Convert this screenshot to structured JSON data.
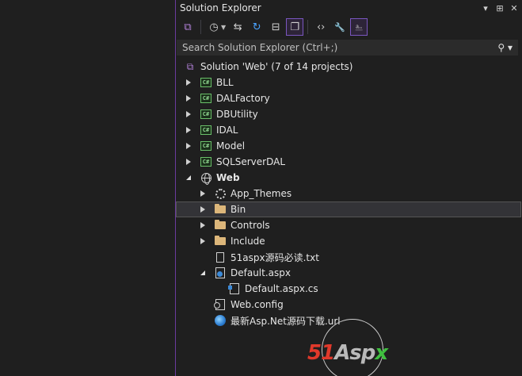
{
  "panel": {
    "title": "Solution Explorer",
    "window_controls": {
      "dropdown": "▾",
      "pin": "⊞",
      "close": "✕"
    }
  },
  "toolbar": {
    "buttons": [
      {
        "icon": "vs-solution-icon",
        "glyph": "⧉"
      },
      {
        "icon": "history-icon",
        "glyph": "◷"
      },
      {
        "icon": "sync-icon",
        "glyph": "⇆"
      },
      {
        "icon": "refresh-icon",
        "glyph": "↻"
      },
      {
        "icon": "collapse-all-icon",
        "glyph": "⊟"
      },
      {
        "icon": "show-all-files-icon",
        "glyph": "❐"
      },
      {
        "icon": "code-view-icon",
        "glyph": "‹›"
      },
      {
        "icon": "properties-icon",
        "glyph": "🔧"
      },
      {
        "icon": "preview-icon",
        "glyph": "⎁"
      }
    ]
  },
  "search": {
    "placeholder": "Search Solution Explorer (Ctrl+;)",
    "value": ""
  },
  "tree": {
    "solution": "Solution 'Web' (7 of 14 projects)",
    "projects": [
      "BLL",
      "DALFactory",
      "DBUtility",
      "IDAL",
      "Model",
      "SQLServerDAL"
    ],
    "web_project": "Web",
    "web_children": [
      {
        "label": "App_Themes",
        "type": "theme"
      },
      {
        "label": "Bin",
        "type": "folder"
      },
      {
        "label": "Controls",
        "type": "folder"
      },
      {
        "label": "Include",
        "type": "folder"
      },
      {
        "label": "51aspx源码必读.txt",
        "type": "file"
      },
      {
        "label": "Default.aspx",
        "type": "aspx"
      },
      {
        "label": "Default.aspx.cs",
        "type": "cs"
      },
      {
        "label": "Web.config",
        "type": "config"
      },
      {
        "label": "最新Asp.Net源码下载.url",
        "type": "url"
      }
    ]
  },
  "watermark": {
    "brand_51": "51",
    "brand_asp": "Asp",
    "brand_x": "x"
  },
  "colors": {
    "accent": "#6a3b9e",
    "folder": "#dcb67a",
    "csharp": "#6abf69"
  }
}
